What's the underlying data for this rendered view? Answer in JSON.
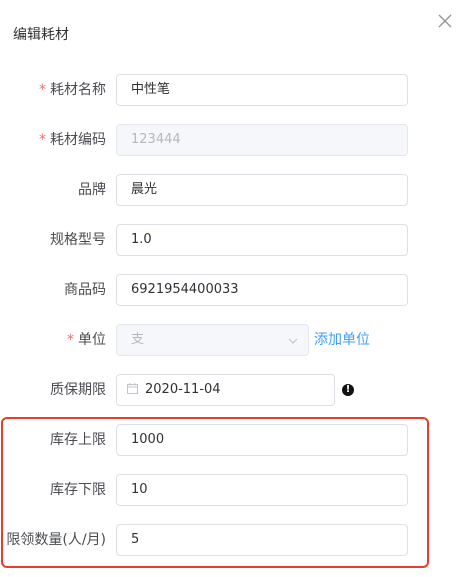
{
  "dialog": {
    "title": "编辑耗材",
    "close_icon": "close-icon"
  },
  "form": {
    "name": {
      "label": "耗材名称",
      "required": "*",
      "value": "中性笔"
    },
    "code": {
      "label": "耗材编码",
      "required": "*",
      "value": "123444"
    },
    "brand": {
      "label": "品牌",
      "value": "晨光"
    },
    "spec": {
      "label": "规格型号",
      "value": "1.0"
    },
    "barcode": {
      "label": "商品码",
      "value": "6921954400033"
    },
    "unit": {
      "label": "单位",
      "required": "*",
      "value": "支",
      "add_link": "添加单位"
    },
    "warranty": {
      "label": "质保期限",
      "value": "2020-11-04",
      "info_glyph": "!"
    },
    "stock_max": {
      "label": "库存上限",
      "value": "1000"
    },
    "stock_min": {
      "label": "库存下限",
      "value": "10"
    },
    "limit": {
      "label": "限领数量(人/月)",
      "value": "5"
    }
  },
  "colors": {
    "required": "#f56c6c",
    "link": "#409eff",
    "highlight_border": "#e53e2e"
  }
}
